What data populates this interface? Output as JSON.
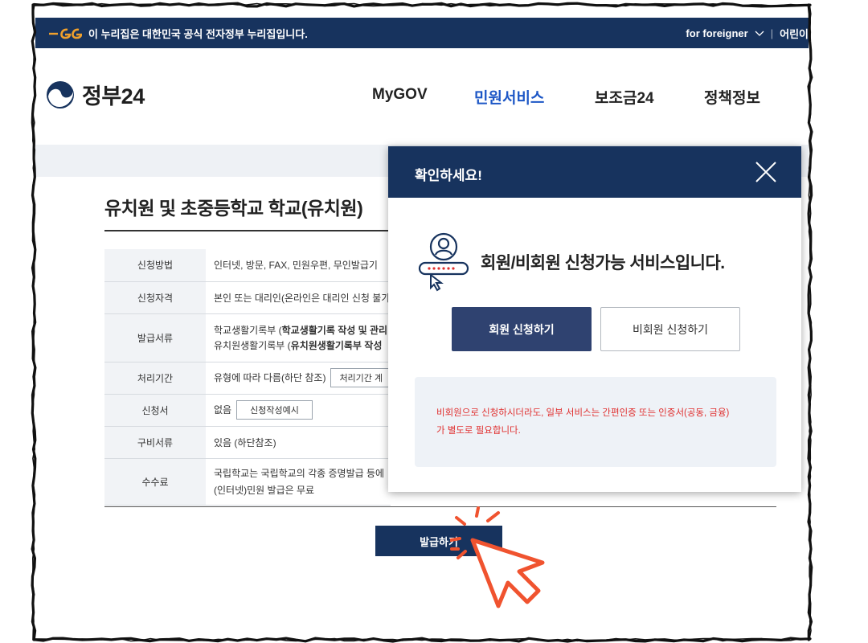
{
  "top_bar": {
    "notice": "이 누리집은 대한민국 공식 전자정부 누리집입니다.",
    "foreigner": "for foreigner",
    "kids": "어린이"
  },
  "header": {
    "logo": "정부24",
    "nav": [
      "MyGOV",
      "민원서비스",
      "보조금24",
      "정책정보"
    ],
    "active_nav": "민원서비스"
  },
  "page": {
    "title": "유치원 및 초중등학교 학교(유치원)",
    "rows": [
      {
        "label": "신청방법",
        "value": "인터넷, 방문, FAX, 민원우편, 무인발급기"
      },
      {
        "label": "신청자격",
        "value": "본인 또는 대리인(온라인은 대리인 신청 불가"
      },
      {
        "label": "발급서류",
        "line1": "학교생활기록부 (",
        "line1_bold": "학교생활기록 작성 및 관리",
        "line2": "유치원생활기록부 (",
        "line2_bold": "유치원생활기록부 작성"
      },
      {
        "label": "처리기간",
        "value": "유형에 따라 다름(하단 참조)",
        "button": "처리기간 계"
      },
      {
        "label": "신청서",
        "value": "없음",
        "button": "신청작성예시"
      },
      {
        "label": "구비서류",
        "value": "있음 (하단참조)"
      },
      {
        "label": "수수료",
        "line1": "국립학교는 국립학교의 각종 증명발급 등에",
        "line2": "(인터넷)민원 발급은 무료"
      }
    ],
    "issue_button": "발급하기"
  },
  "modal": {
    "title": "확인하세요!",
    "message": "회원/비회원 신청가능 서비스입니다.",
    "member_button": "회원 신청하기",
    "guest_button": "비회원 신청하기",
    "warning_line1": "비회원으로 신청하시더라도, 일부 서비스는 간편인증 또는 인증서(공동, 금융)",
    "warning_line2": "가 별도로 필요합니다."
  },
  "colors": {
    "navy": "#17335e",
    "button_navy": "#2f4270",
    "link_blue": "#1d57c6",
    "warning_red": "#e0302f",
    "cursor_orange": "#f0532f"
  },
  "icons": [
    "eg-logo-icon",
    "chevron-down-icon",
    "gov24-logo-icon",
    "close-icon",
    "member-login-icon",
    "pointer-cursor-icon"
  ]
}
